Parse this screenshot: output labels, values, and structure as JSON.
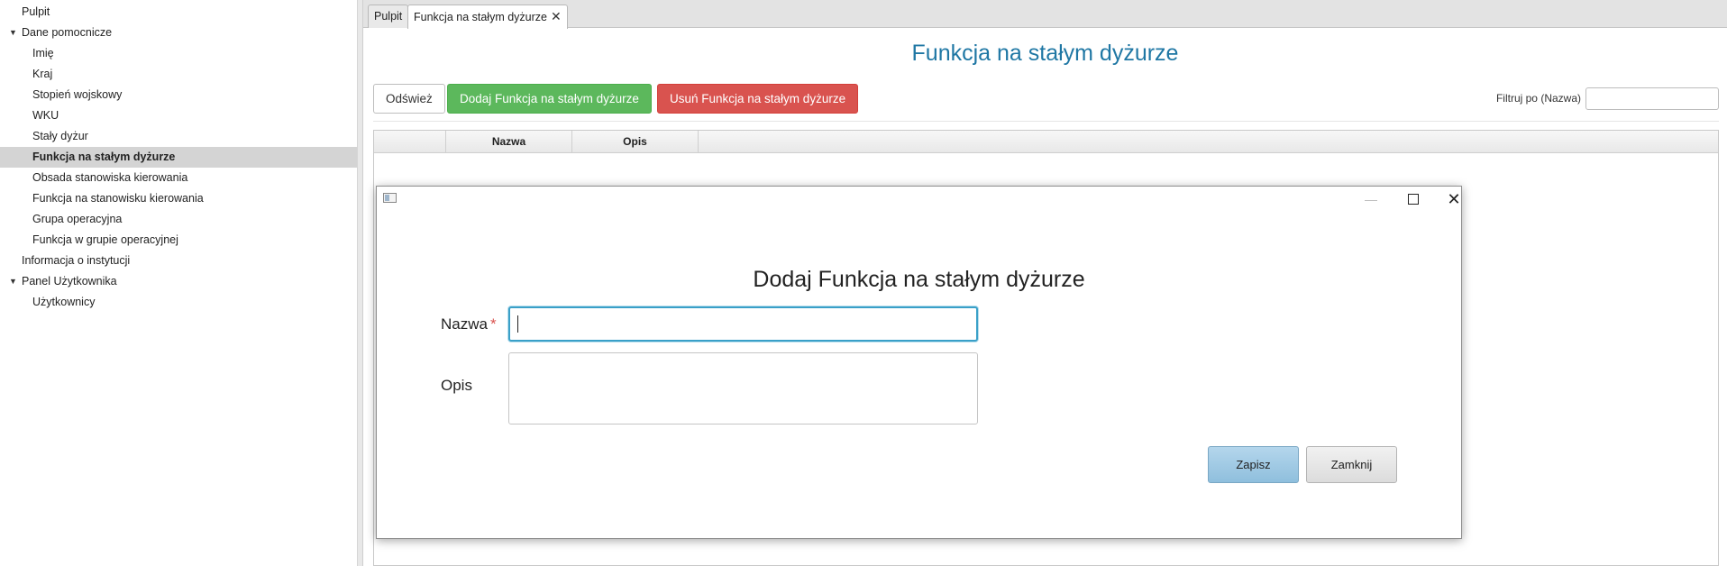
{
  "sidebar": {
    "items": [
      {
        "label": "Pulpit",
        "level": 0
      },
      {
        "label": "Dane pomocnicze",
        "level": 0,
        "expanded": true
      },
      {
        "label": "Imię",
        "level": 1
      },
      {
        "label": "Kraj",
        "level": 1
      },
      {
        "label": "Stopień wojskowy",
        "level": 1
      },
      {
        "label": "WKU",
        "level": 1
      },
      {
        "label": "Stały dyżur",
        "level": 1
      },
      {
        "label": "Funkcja na stałym dyżurze",
        "level": 1,
        "selected": true
      },
      {
        "label": "Obsada stanowiska kierowania",
        "level": 1
      },
      {
        "label": "Funkcja na stanowisku kierowania",
        "level": 1
      },
      {
        "label": "Grupa operacyjna",
        "level": 1
      },
      {
        "label": "Funkcja w grupie operacyjnej",
        "level": 1
      },
      {
        "label": "Informacja o instytucji",
        "level": 0
      },
      {
        "label": "Panel Użytkownika",
        "level": 0,
        "expanded": true
      },
      {
        "label": "Użytkownicy",
        "level": 1
      }
    ],
    "expand_glyph": "▼"
  },
  "tabs": [
    {
      "label": "Pulpit",
      "active": false
    },
    {
      "label": "Funkcja na stałym dyżurze",
      "active": true,
      "close_glyph": "✕"
    }
  ],
  "main": {
    "title": "Funkcja na stałym dyżurze",
    "toolbar": {
      "refresh_label": "Odśwież",
      "add_label": "Dodaj Funkcja na stałym dyżurze",
      "delete_label": "Usuń Funkcja na stałym dyżurze"
    },
    "filter": {
      "label": "Filtruj po (Nazwa)",
      "value": ""
    },
    "table": {
      "columns": [
        "",
        "Nazwa",
        "Opis"
      ]
    }
  },
  "dialog": {
    "title": "Dodaj Funkcja na stałym dyżurze",
    "window_controls": {
      "minimize": "—",
      "close": "✕"
    },
    "fields": {
      "nazwa_label": "Nazwa",
      "required_mark": "*",
      "nazwa_value": "",
      "opis_label": "Opis",
      "opis_value": ""
    },
    "save_label": "Zapisz",
    "close_label": "Zamknij"
  },
  "colors": {
    "title_blue": "#1f77a4",
    "add_green": "#5cb85c",
    "delete_red": "#d9534f",
    "focus_blue": "#3aa0c8",
    "save_blue": "#9fc9e4"
  }
}
